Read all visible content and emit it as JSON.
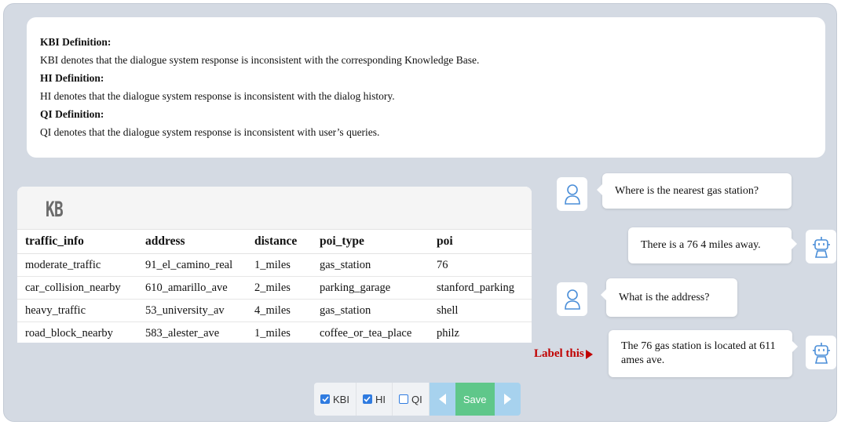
{
  "definitions": [
    {
      "heading": "KBI Definition:",
      "text": "KBI denotes that the dialogue system response is inconsistent with the corresponding Knowledge Base."
    },
    {
      "heading": "HI Definition:",
      "text": "HI denotes that the dialogue system response is inconsistent with the dialog history."
    },
    {
      "heading": "QI Definition:",
      "text": "QI denotes that the dialogue system response is inconsistent with user’s queries."
    }
  ],
  "kb": {
    "title": "KB",
    "columns": [
      "traffic_info",
      "address",
      "distance",
      "poi_type",
      "poi"
    ],
    "rows": [
      [
        "moderate_traffic",
        "91_el_camino_real",
        "1_miles",
        "gas_station",
        "76"
      ],
      [
        "car_collision_nearby",
        "610_amarillo_ave",
        "2_miles",
        "parking_garage",
        "stanford_parking"
      ],
      [
        "heavy_traffic",
        "53_university_av",
        "4_miles",
        "gas_station",
        "shell"
      ],
      [
        "road_block_nearby",
        "583_alester_ave",
        "1_miles",
        "coffee_or_tea_place",
        "philz"
      ]
    ]
  },
  "dialog": [
    {
      "speaker": "user",
      "text": "Where is the nearest gas station?"
    },
    {
      "speaker": "system",
      "text": "There is a 76 4 miles away."
    },
    {
      "speaker": "user",
      "text": "What is the address?"
    },
    {
      "speaker": "system",
      "text": "The 76 gas station is located at 611 ames ave."
    }
  ],
  "label_marker": "Label this",
  "toolbar": {
    "checkboxes": [
      {
        "label": "KBI",
        "checked": true
      },
      {
        "label": "HI",
        "checked": true
      },
      {
        "label": "QI",
        "checked": false
      }
    ],
    "save_label": "Save"
  },
  "icons": {
    "user": "user-icon",
    "system": "robot-icon"
  },
  "colors": {
    "accent": "#2f7be0",
    "save": "#5fc78a",
    "nav": "#a7d2ee",
    "label": "#c00000",
    "panel": "#d4dae3"
  }
}
